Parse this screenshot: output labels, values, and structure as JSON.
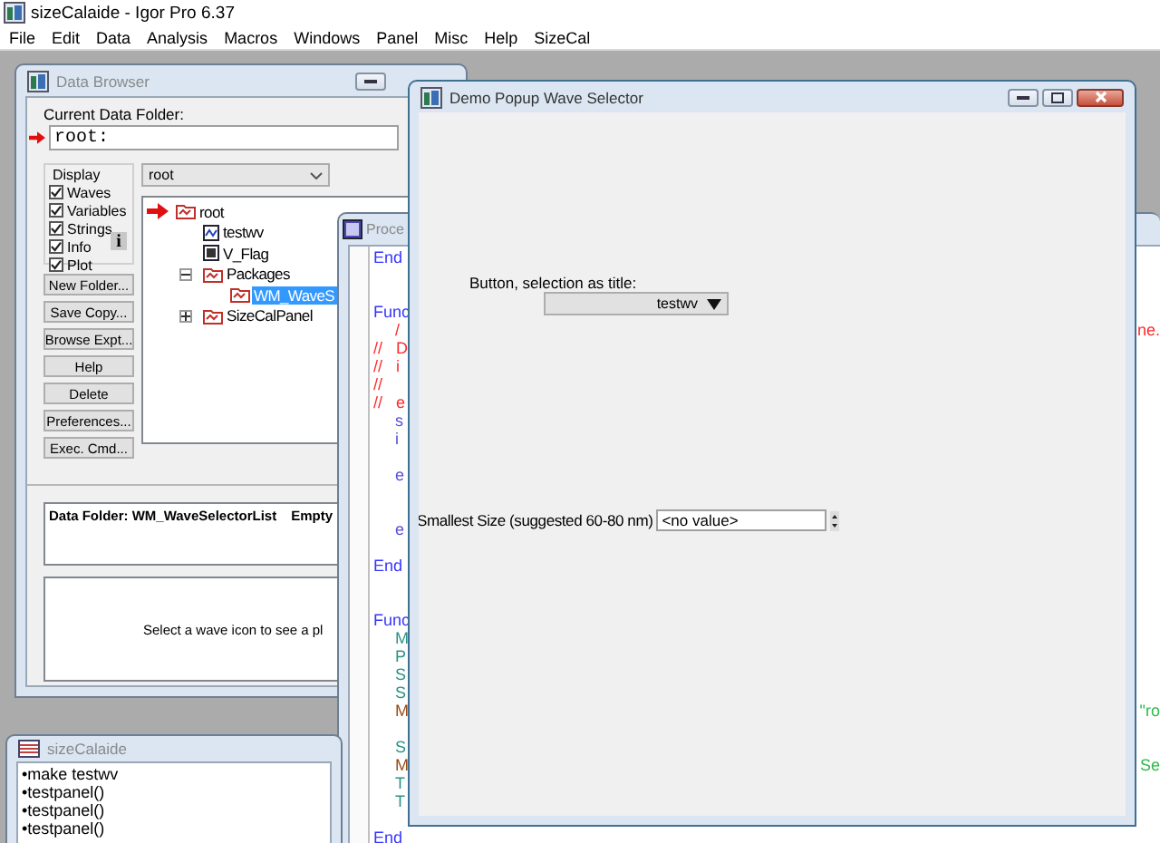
{
  "app": {
    "title": "sizeCalaide - Igor Pro 6.37"
  },
  "menu": [
    "File",
    "Edit",
    "Data",
    "Analysis",
    "Macros",
    "Windows",
    "Panel",
    "Misc",
    "Help",
    "SizeCal"
  ],
  "data_browser": {
    "title": "Data Browser",
    "folder_label": "Current Data Folder:",
    "folder_value": "root:",
    "display_label": "Display",
    "display_options": [
      {
        "label": "Waves",
        "checked": true
      },
      {
        "label": "Variables",
        "checked": true
      },
      {
        "label": "Strings",
        "checked": true
      },
      {
        "label": "Info",
        "checked": true
      },
      {
        "label": "Plot",
        "checked": true
      }
    ],
    "info_button": "i",
    "dropdown": "root",
    "buttons": [
      "New Folder...",
      "Save Copy...",
      "Browse Expt...",
      "Help",
      "Delete",
      "Preferences...",
      "Exec. Cmd..."
    ],
    "tree": [
      {
        "label": "root",
        "kind": "folder",
        "current": true,
        "selected": false,
        "children": [
          {
            "label": "testwv",
            "kind": "wave",
            "current": false,
            "selected": false
          },
          {
            "label": "V_Flag",
            "kind": "variable",
            "current": false,
            "selected": false
          },
          {
            "label": "Packages",
            "kind": "folder",
            "current": false,
            "selected": false,
            "expanded": true,
            "children": [
              {
                "label": "WM_WaveS",
                "kind": "folder",
                "current": false,
                "selected": true
              }
            ]
          },
          {
            "label": "SizeCalPanel",
            "kind": "folder",
            "current": false,
            "selected": false,
            "expanded": false
          }
        ]
      }
    ],
    "info_folder": "Data Folder: WM_WaveSelectorList",
    "info_status": "Empty",
    "plot_hint": "Select a wave icon to see a pl"
  },
  "procedure": {
    "title": "Proce",
    "lines": [
      {
        "kind": "keyword",
        "text": "End"
      },
      {
        "kind": "blank"
      },
      {
        "kind": "blank"
      },
      {
        "kind": "keyword",
        "text": "Func"
      },
      {
        "kind": "doc",
        "text": "/",
        "tail": {
          "kind": "comment",
          "text": "ne."
        }
      },
      {
        "kind": "comment",
        "text": "//   D"
      },
      {
        "kind": "comment",
        "text": "//   i"
      },
      {
        "kind": "comment",
        "text": "//"
      },
      {
        "kind": "comment",
        "text": "//   e"
      },
      {
        "kind": "command",
        "text": "s"
      },
      {
        "kind": "command",
        "text": "i"
      },
      {
        "kind": "blank"
      },
      {
        "kind": "command",
        "text": "e"
      },
      {
        "kind": "blank"
      },
      {
        "kind": "blank"
      },
      {
        "kind": "command",
        "text": "e"
      },
      {
        "kind": "blank"
      },
      {
        "kind": "keyword",
        "text": "End"
      },
      {
        "kind": "blank"
      },
      {
        "kind": "blank"
      },
      {
        "kind": "keyword",
        "text": "Func"
      },
      {
        "kind": "operation",
        "text": "M"
      },
      {
        "kind": "operation",
        "text": "P"
      },
      {
        "kind": "operation",
        "text": "S"
      },
      {
        "kind": "operation",
        "text": "S"
      },
      {
        "kind": "function",
        "text": "M",
        "tail": {
          "kind": "string",
          "text": "\"ro"
        }
      },
      {
        "kind": "blank"
      },
      {
        "kind": "operation",
        "text": "S"
      },
      {
        "kind": "function",
        "text": "M",
        "tail": {
          "kind": "string",
          "text": "Se"
        }
      },
      {
        "kind": "operation",
        "text": "T"
      },
      {
        "kind": "operation",
        "text": "T"
      },
      {
        "kind": "blank"
      },
      {
        "kind": "keyword",
        "text": "End"
      }
    ]
  },
  "demo_panel": {
    "title": "Demo Popup Wave Selector",
    "popup_label": "Button, selection as title:",
    "popup_value": "testwv",
    "size_label": "Smallest Size (suggested 60-80 nm)",
    "size_value": "<no value>"
  },
  "command_window": {
    "title": "sizeCalaide",
    "history": [
      "•make testwv",
      "•testpanel()",
      "•testpanel()",
      "•testpanel()"
    ]
  }
}
